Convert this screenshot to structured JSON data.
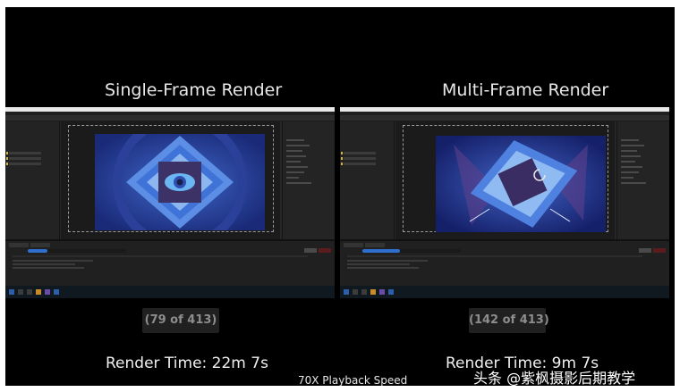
{
  "left": {
    "title": "Single-Frame Render",
    "counter": "(79 of 413)",
    "render_time": "Render Time: 22m 7s",
    "progress": 0.2
  },
  "right": {
    "title": "Multi-Frame Render",
    "counter": "(142 of 413)",
    "render_time": "Render Time: 9m 7s",
    "progress": 0.38
  },
  "playback_speed": "70X Playback Speed",
  "watermark": "头条 @紫枫摄影后期教学",
  "icons": [
    "eye-icon",
    "spinner-icon"
  ],
  "colors": {
    "background": "#000000",
    "progress_bar": "#2e6fcf",
    "viewer_blue": "#2b4fb0"
  }
}
